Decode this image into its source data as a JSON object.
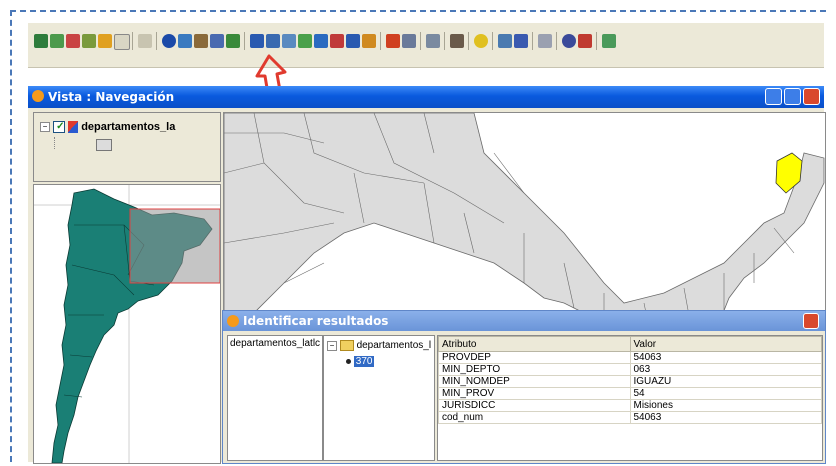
{
  "toc": {
    "layer_name": "departamentos_la"
  },
  "window": {
    "title": "Vista : Navegación"
  },
  "identify": {
    "title": "Identificar resultados",
    "layer_left": "departamentos_latlc",
    "tree_root": "departamentos_l",
    "tree_item": "370",
    "col_attr": "Atributo",
    "col_value": "Valor",
    "rows": [
      {
        "attr": "PROVDEP",
        "value": "54063"
      },
      {
        "attr": "MIN_DEPTO",
        "value": "063"
      },
      {
        "attr": "MIN_NOMDEP",
        "value": "IGUAZU"
      },
      {
        "attr": "MIN_PROV",
        "value": "54"
      },
      {
        "attr": "JURISDICC",
        "value": "Misiones"
      },
      {
        "attr": "cod_num",
        "value": "54063"
      }
    ]
  },
  "colors": {
    "map_fill": "#dcdcdc",
    "selected_fill": "#ffff00",
    "overview_fill": "#1a7f75",
    "titlebar": "#0a5ade",
    "arrow": "#e03a2e"
  },
  "icons": [
    "earth-icon",
    "zoom-extent-icon",
    "layers-icon",
    "arrow-icon",
    "add-layer-icon",
    "clock-icon",
    "back-icon",
    "info-icon",
    "zoom-icon",
    "table-icon",
    "grid-icon",
    "edit-icon",
    "pointer-icon",
    "select-icon",
    "select-rect-icon",
    "polygon-icon",
    "window-icon",
    "measure-icon",
    "zoom-in-icon",
    "point-icon",
    "filter-icon",
    "chart-icon",
    "grid2-icon",
    "tools-icon",
    "light-icon",
    "zoom-layer-icon",
    "zoom-select-icon",
    "edit2-icon",
    "search-icon",
    "map-icon",
    "export-icon"
  ]
}
